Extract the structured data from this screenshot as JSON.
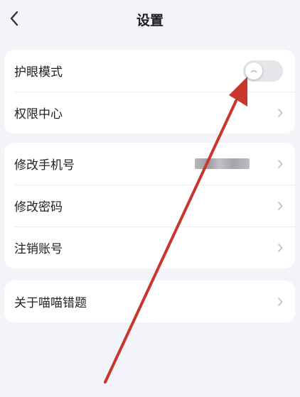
{
  "header": {
    "title": "设置"
  },
  "groups": {
    "eye": {
      "label": "护眼模式",
      "toggle_on": false
    },
    "permission": {
      "label": "权限中心"
    },
    "phone": {
      "label": "修改手机号"
    },
    "password": {
      "label": "修改密码"
    },
    "cancel": {
      "label": "注销账号"
    },
    "about": {
      "label": "关于喵喵错题"
    }
  },
  "colors": {
    "background": "#f3f4f9",
    "card": "#ffffff",
    "annotation_arrow": "#c8372d"
  }
}
